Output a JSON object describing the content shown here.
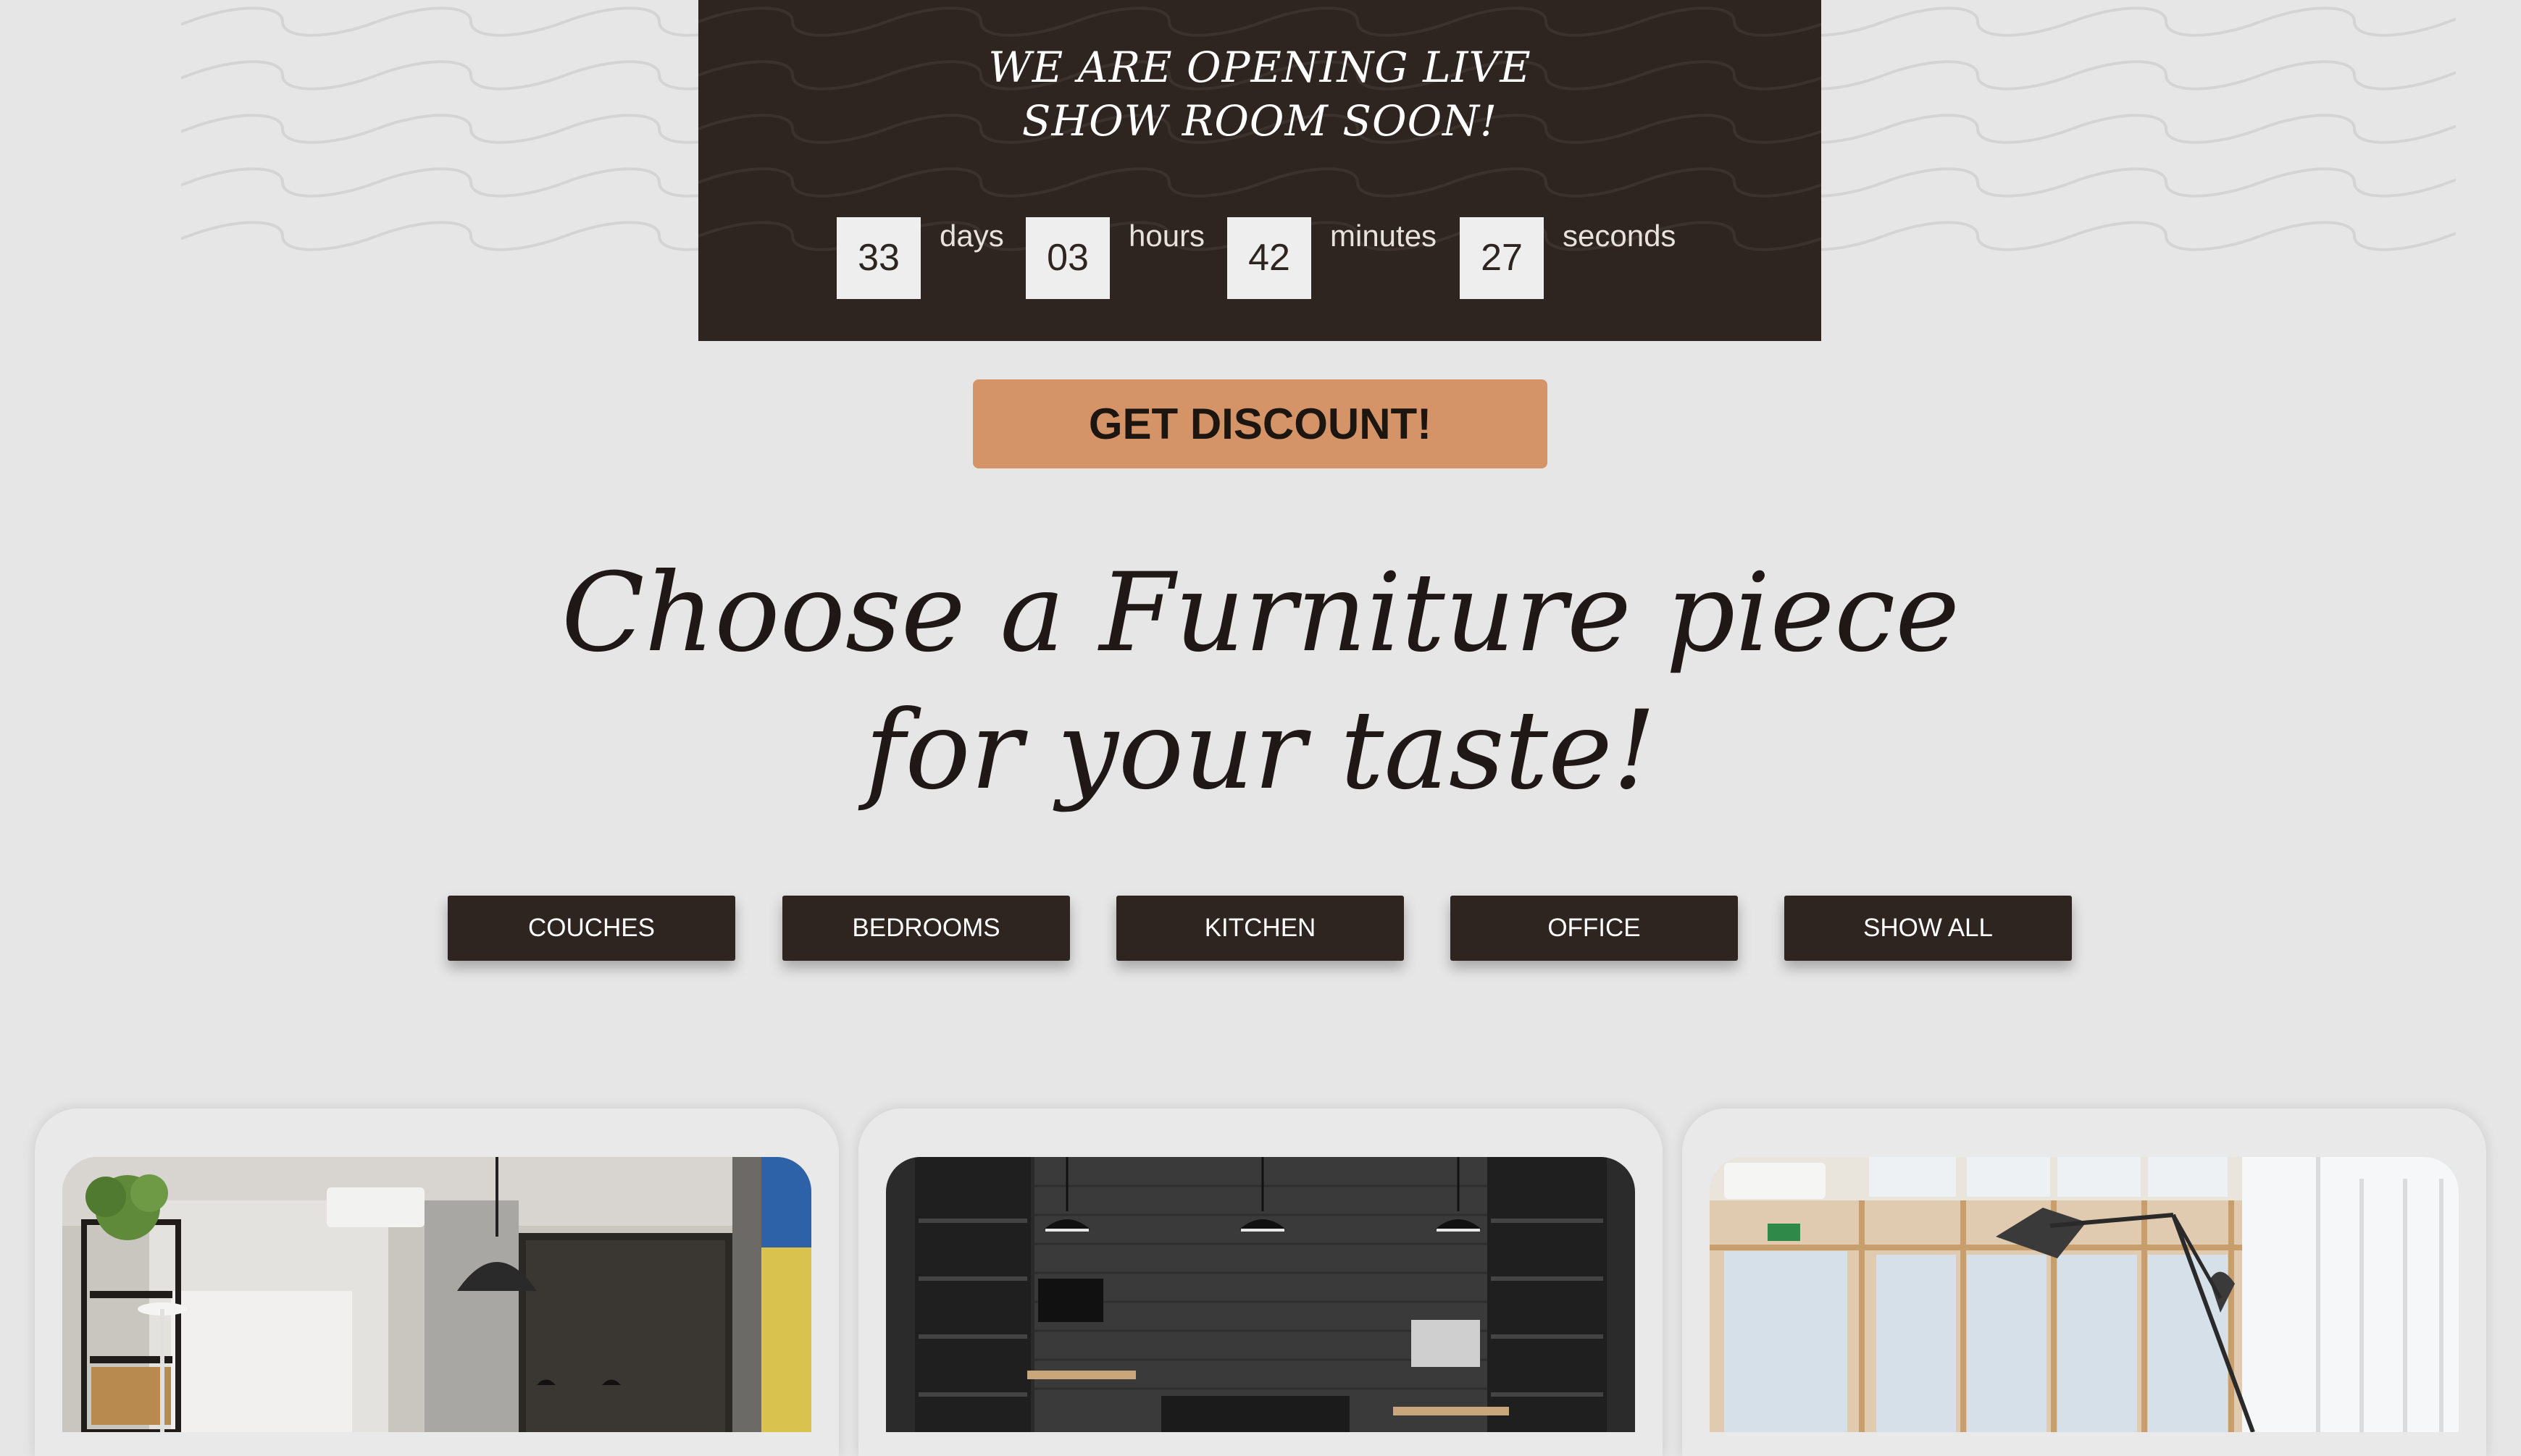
{
  "banner": {
    "title": "WE ARE OPENING LIVE\nSHOW ROOM SOON!",
    "countdown": [
      {
        "value": "33",
        "unit": "days"
      },
      {
        "value": "03",
        "unit": "hours"
      },
      {
        "value": "42",
        "unit": "minutes"
      },
      {
        "value": "27",
        "unit": "seconds"
      }
    ]
  },
  "discount": {
    "label": "GET DISCOUNT!"
  },
  "headline": "Choose a Furniture piece\nfor your taste!",
  "categories": [
    {
      "label": "COUCHES"
    },
    {
      "label": "BEDROOMS"
    },
    {
      "label": "KITCHEN"
    },
    {
      "label": "OFFICE"
    },
    {
      "label": "SHOW ALL"
    }
  ],
  "products": [
    {
      "image": "office-loft-photo"
    },
    {
      "image": "dark-office-photo"
    },
    {
      "image": "bright-office-photo"
    }
  ],
  "colors": {
    "page_bg": "#e6e6e6",
    "banner_bg": "#2e2420",
    "accent": "#d49467",
    "button_bg": "#2e2420",
    "text_dark": "#1f1816"
  }
}
